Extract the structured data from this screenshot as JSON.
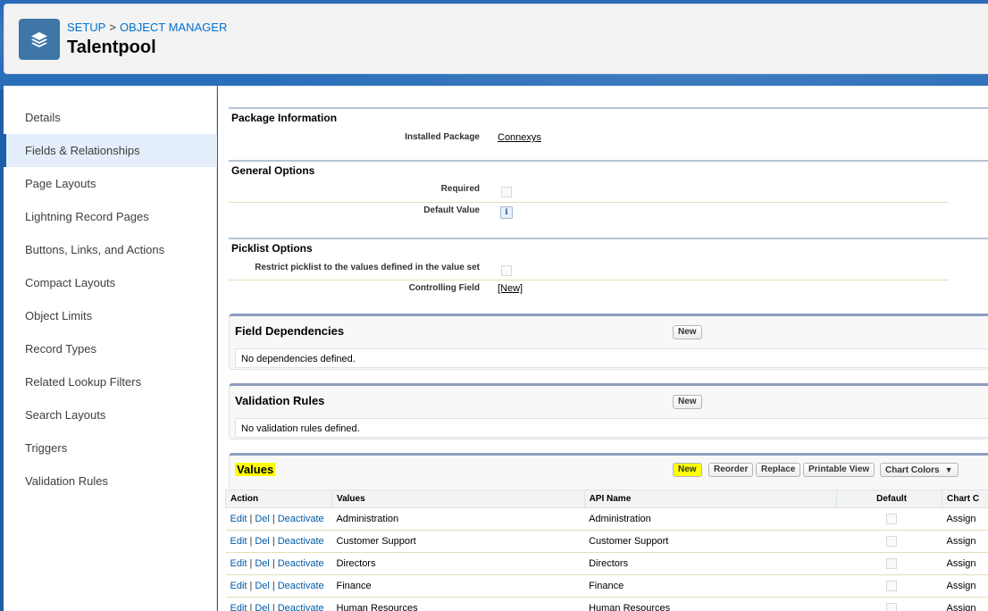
{
  "header": {
    "breadcrumb": [
      "SETUP",
      "OBJECT MANAGER"
    ],
    "breadcrumb_separator": ">",
    "title": "Talentpool",
    "icon": "layers-icon"
  },
  "sidebar": {
    "items": [
      {
        "label": "Details",
        "active": false
      },
      {
        "label": "Fields & Relationships",
        "active": true
      },
      {
        "label": "Page Layouts",
        "active": false
      },
      {
        "label": "Lightning Record Pages",
        "active": false
      },
      {
        "label": "Buttons, Links, and Actions",
        "active": false
      },
      {
        "label": "Compact Layouts",
        "active": false
      },
      {
        "label": "Object Limits",
        "active": false
      },
      {
        "label": "Record Types",
        "active": false
      },
      {
        "label": "Related Lookup Filters",
        "active": false
      },
      {
        "label": "Search Layouts",
        "active": false
      },
      {
        "label": "Triggers",
        "active": false
      },
      {
        "label": "Validation Rules",
        "active": false
      }
    ]
  },
  "detail": {
    "package_section": {
      "title": "Package Information",
      "installed_package_label": "Installed Package",
      "installed_package_value": "Connexys"
    },
    "general_section": {
      "title": "General Options",
      "required_label": "Required",
      "default_value_label": "Default Value",
      "info_glyph": "i"
    },
    "picklist_section": {
      "title": "Picklist Options",
      "restrict_label": "Restrict picklist to the values defined in the value set",
      "controlling_field_label": "Controlling Field",
      "controlling_field_value": "[New]"
    }
  },
  "field_dependencies": {
    "title": "Field Dependencies",
    "new_label": "New",
    "empty_text": "No dependencies defined."
  },
  "validation_rules": {
    "title": "Validation Rules",
    "new_label": "New",
    "empty_text": "No validation rules defined."
  },
  "values": {
    "title": "Values",
    "buttons": {
      "new": "New",
      "reorder": "Reorder",
      "replace": "Replace",
      "printable_view": "Printable View",
      "chart_colors": "Chart Colors"
    },
    "columns": [
      "Action",
      "Values",
      "API Name",
      "Default",
      "Chart C"
    ],
    "action_links": [
      "Edit",
      "Del",
      "Deactivate"
    ],
    "rows": [
      {
        "value": "Administration",
        "api_name": "Administration",
        "chart": "Assign"
      },
      {
        "value": "Customer Support",
        "api_name": "Customer Support",
        "chart": "Assign"
      },
      {
        "value": "Directors",
        "api_name": "Directors",
        "chart": "Assign"
      },
      {
        "value": "Finance",
        "api_name": "Finance",
        "chart": "Assign"
      },
      {
        "value": "Human Resources",
        "api_name": "Human Resources",
        "chart": "Assign"
      }
    ]
  },
  "colors": {
    "brand_blue": "#1f5ea8",
    "link_blue": "#015ba7",
    "highlight_yellow": "#ffff00",
    "active_nav_bg": "#e4effb"
  }
}
